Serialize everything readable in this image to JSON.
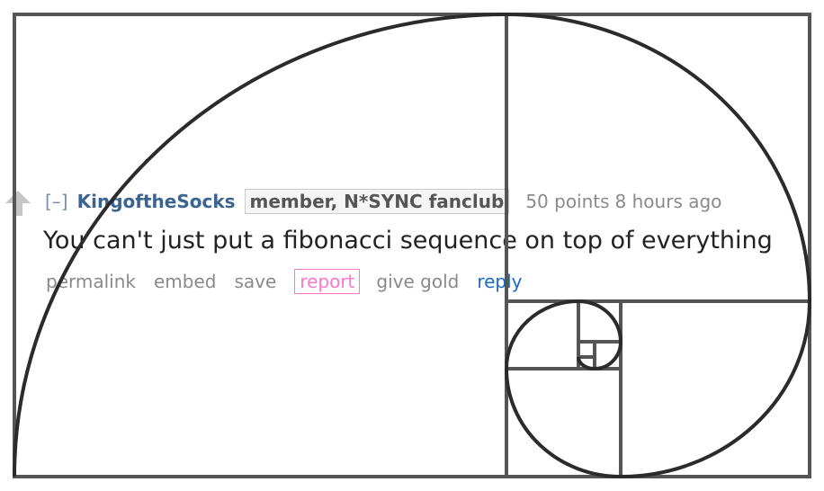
{
  "colors": {
    "spiral_stroke": "#2b2b2b",
    "grid_stroke": "#555555",
    "author": "#3a6391",
    "muted": "#8a8a8a",
    "report_highlight": "#ff77cc",
    "reply_link": "#1a6bc4",
    "upvote": "#c6c6c6"
  },
  "overlay": {
    "icon": "golden-spiral"
  },
  "comment": {
    "vote": {
      "icon": "upvote-arrow-icon"
    },
    "collapse": "[–]",
    "author": "KingoftheSocks",
    "flair": "member, N*SYNC fanclub",
    "score": "50 points",
    "time": "8 hours ago",
    "body": "You can't just put a fibonacci sequence on top of everything",
    "actions": {
      "permalink": "permalink",
      "embed": "embed",
      "save": "save",
      "report": "report",
      "give_gold": "give gold",
      "reply": "reply"
    }
  }
}
